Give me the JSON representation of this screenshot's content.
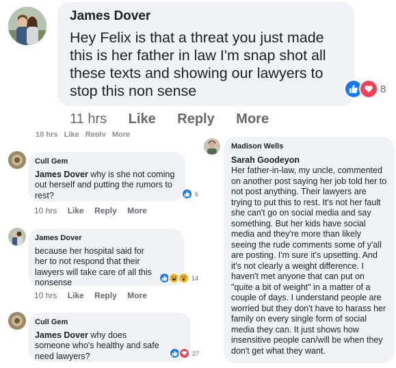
{
  "top_comment": {
    "author": "James Dover",
    "text": "Hey Felix is that a threat you just made this is her father in law I'm snap shot all these texts and showing our lawyers to stop this non sense",
    "time": "11 hrs",
    "like_label": "Like",
    "reply_label": "Reply",
    "more_label": "More",
    "reaction_count": "8",
    "cut_meta": "10 hrs   Like   Reply   More"
  },
  "comments": [
    {
      "author": "Cull Gem",
      "mention": "James Dover",
      "text": " why is she not coming out herself and putting the rumors to rest?",
      "time": "10 hrs",
      "like_label": "Like",
      "reply_label": "Reply",
      "more_label": "More",
      "reaction_count": "6"
    },
    {
      "author": "James Dover",
      "text": "because her hospital said for her to not respond that their lawyers will take care of all this nonsense",
      "time": "10 hrs",
      "like_label": "Like",
      "reply_label": "Reply",
      "more_label": "More",
      "reaction_count": "14"
    },
    {
      "author": "Cull Gem",
      "mention": "James Dover",
      "text": " why does someone who's healthy and safe need lawyers?",
      "reaction_count": "27"
    }
  ],
  "right_comment": {
    "author": "Madison Wells",
    "mention": "Sarah Goodeyon",
    "text": "Her father-in-law, my uncle, commented on another post saying her job told her to not post anything. Their lawyers are trying to put this to rest. It's not her fault she can't go on social media and say something. But her kids have social media and they're more than likely seeing the rude comments some of y'all are posting. I'm sure it's upsetting. And it's not clearly a weight difference. I haven't met anyone that can put on \"quite a bit of weight\" in a matter of a couple of days. I understand people are worried but they don't have to harass her family on every single form of social media they can. It just shows how insensitive people can/will be when they don't get what they want."
  },
  "colors": {
    "like": "#1877f2",
    "love": "#f33e58",
    "haha": "#f7b125",
    "bubble": "#f0f2f5",
    "meta": "#65676b"
  }
}
